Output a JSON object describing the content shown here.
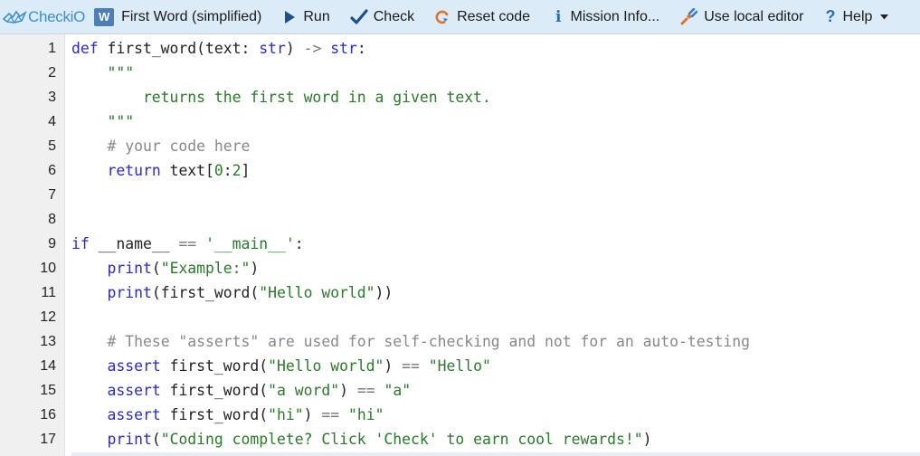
{
  "toolbar": {
    "logo": "CheckiO",
    "mission_badge": "W",
    "mission_title": "First Word (simplified)",
    "run_label": "Run",
    "check_label": "Check",
    "reset_label": "Reset code",
    "info_glyph": "i",
    "info_label": "Mission Info...",
    "local_editor_label": "Use local editor",
    "help_glyph": "?",
    "help_label": "Help"
  },
  "colors": {
    "toolbar_bg": "#dcebf8",
    "keyword": "#2a2ad0",
    "string": "#2a7a2a",
    "comment": "#888888",
    "accent": "#2f6db0"
  },
  "editor": {
    "lines": [
      {
        "n": "1",
        "parts": [
          [
            "kw",
            "def"
          ],
          [
            "",
            " first_word(text: "
          ],
          [
            "kw",
            "str"
          ],
          [
            "",
            ") "
          ],
          [
            "op",
            "->"
          ],
          [
            "",
            " "
          ],
          [
            "kw",
            "str"
          ],
          [
            "",
            ":"
          ]
        ]
      },
      {
        "n": "2",
        "parts": [
          [
            "",
            "    "
          ],
          [
            "str",
            "\"\"\""
          ]
        ]
      },
      {
        "n": "3",
        "parts": [
          [
            "str",
            "        returns the first word in a given text."
          ]
        ]
      },
      {
        "n": "4",
        "parts": [
          [
            "",
            "    "
          ],
          [
            "str",
            "\"\"\""
          ]
        ]
      },
      {
        "n": "5",
        "parts": [
          [
            "",
            "    "
          ],
          [
            "cmt",
            "# your code here"
          ]
        ]
      },
      {
        "n": "6",
        "parts": [
          [
            "",
            "    "
          ],
          [
            "kw",
            "return"
          ],
          [
            "",
            " text["
          ],
          [
            "num",
            "0"
          ],
          [
            "",
            ":"
          ],
          [
            "num",
            "2"
          ],
          [
            "",
            "]"
          ]
        ]
      },
      {
        "n": "7",
        "parts": []
      },
      {
        "n": "8",
        "parts": []
      },
      {
        "n": "9",
        "parts": [
          [
            "kw",
            "if"
          ],
          [
            "",
            " __name__ "
          ],
          [
            "op",
            "=="
          ],
          [
            "",
            " "
          ],
          [
            "str",
            "'__main__'"
          ],
          [
            "",
            ":"
          ]
        ]
      },
      {
        "n": "10",
        "parts": [
          [
            "",
            "    "
          ],
          [
            "builtin",
            "print"
          ],
          [
            "",
            "("
          ],
          [
            "str",
            "\"Example:\""
          ],
          [
            "",
            ")"
          ]
        ]
      },
      {
        "n": "11",
        "parts": [
          [
            "",
            "    "
          ],
          [
            "builtin",
            "print"
          ],
          [
            "",
            "(first_word("
          ],
          [
            "str",
            "\"Hello world\""
          ],
          [
            "",
            "))"
          ]
        ]
      },
      {
        "n": "12",
        "parts": []
      },
      {
        "n": "13",
        "parts": [
          [
            "",
            "    "
          ],
          [
            "cmt",
            "# These \"asserts\" are used for self-checking and not for an auto-testing"
          ]
        ]
      },
      {
        "n": "14",
        "parts": [
          [
            "",
            "    "
          ],
          [
            "kw",
            "assert"
          ],
          [
            "",
            " first_word("
          ],
          [
            "str",
            "\"Hello world\""
          ],
          [
            "",
            ") "
          ],
          [
            "op",
            "=="
          ],
          [
            "",
            " "
          ],
          [
            "str",
            "\"Hello\""
          ]
        ]
      },
      {
        "n": "15",
        "parts": [
          [
            "",
            "    "
          ],
          [
            "kw",
            "assert"
          ],
          [
            "",
            " first_word("
          ],
          [
            "str",
            "\"a word\""
          ],
          [
            "",
            ") "
          ],
          [
            "op",
            "=="
          ],
          [
            "",
            " "
          ],
          [
            "str",
            "\"a\""
          ]
        ]
      },
      {
        "n": "16",
        "parts": [
          [
            "",
            "    "
          ],
          [
            "kw",
            "assert"
          ],
          [
            "",
            " first_word("
          ],
          [
            "str",
            "\"hi\""
          ],
          [
            "",
            ") "
          ],
          [
            "op",
            "=="
          ],
          [
            "",
            " "
          ],
          [
            "str",
            "\"hi\""
          ]
        ]
      },
      {
        "n": "17",
        "parts": [
          [
            "",
            "    "
          ],
          [
            "builtin",
            "print"
          ],
          [
            "",
            "("
          ],
          [
            "str",
            "\"Coding complete? Click 'Check' to earn cool rewards!\""
          ],
          [
            "",
            ")"
          ]
        ]
      }
    ]
  }
}
